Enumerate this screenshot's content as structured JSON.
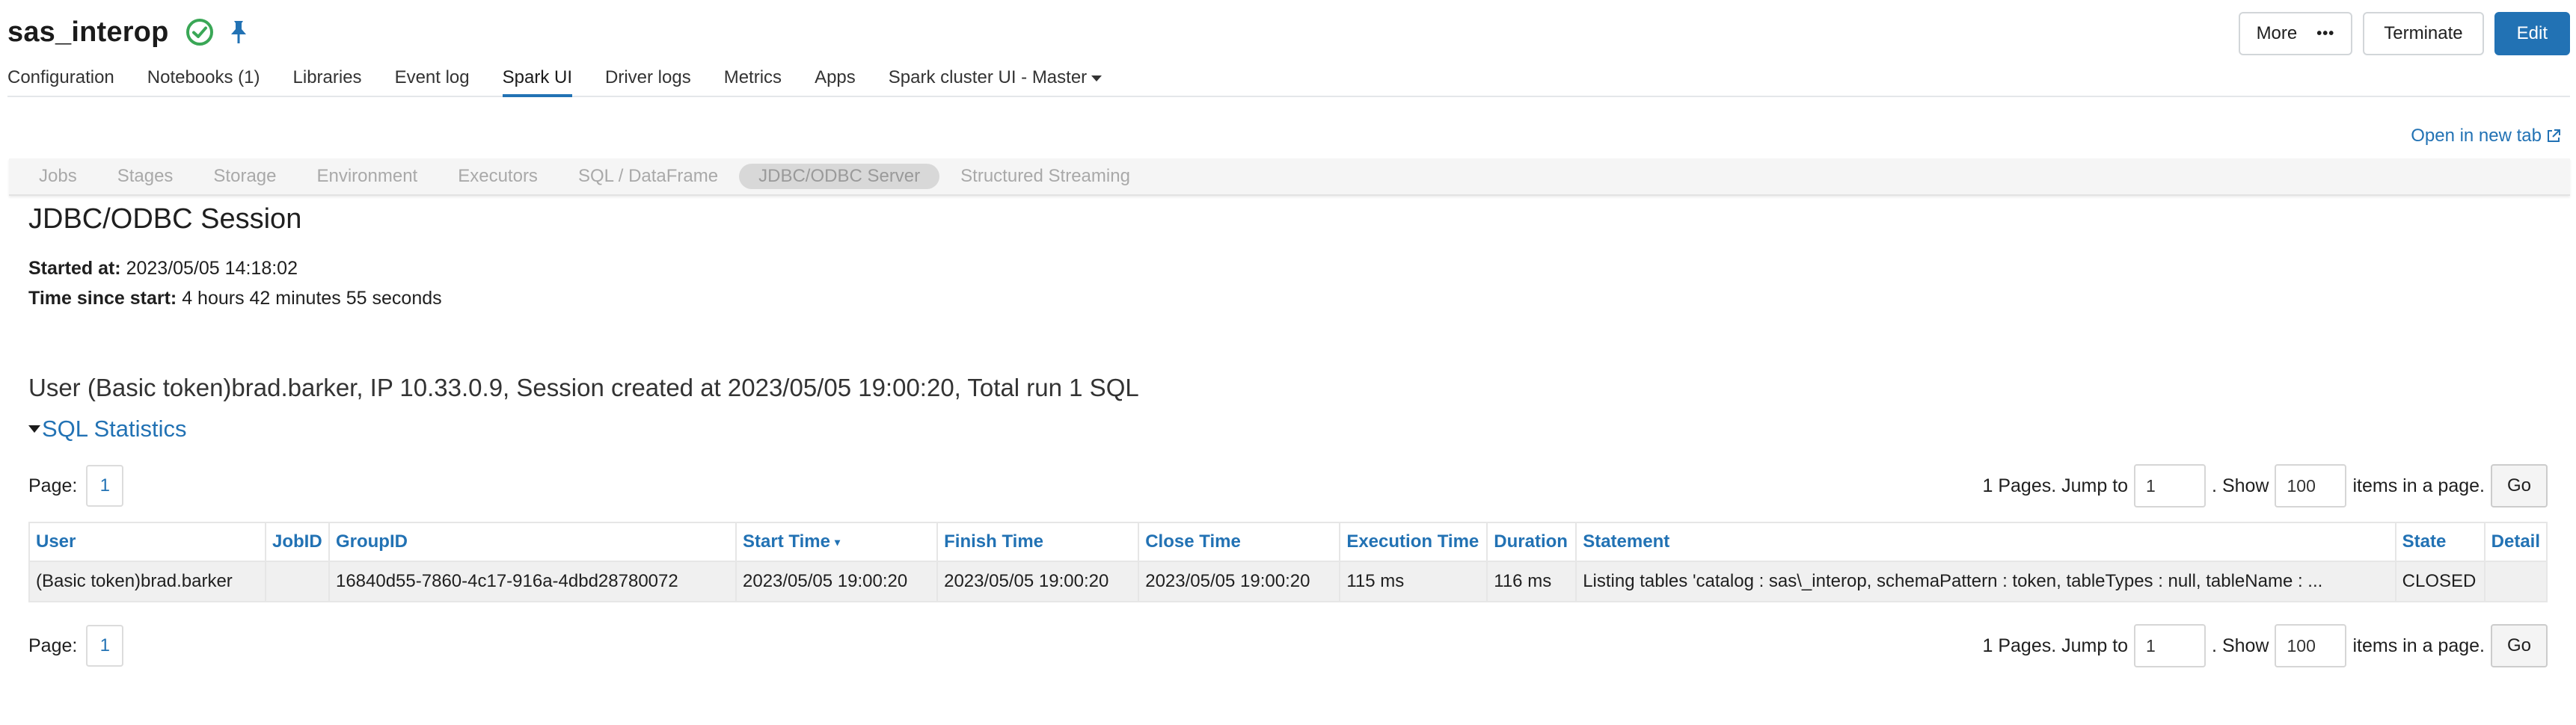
{
  "header": {
    "title": "sas_interop",
    "status_icon": "check-circle-icon",
    "pin_icon": "pin-icon",
    "actions": {
      "more_label": "More",
      "more_icon": "•••",
      "terminate_label": "Terminate",
      "edit_label": "Edit"
    }
  },
  "nav_tabs": [
    {
      "label": "Configuration"
    },
    {
      "label": "Notebooks (1)"
    },
    {
      "label": "Libraries"
    },
    {
      "label": "Event log"
    },
    {
      "label": "Spark UI"
    },
    {
      "label": "Driver logs"
    },
    {
      "label": "Metrics"
    },
    {
      "label": "Apps"
    },
    {
      "label": "Spark cluster UI - Master"
    }
  ],
  "active_tab": "Spark UI",
  "open_new_tab": "Open in new tab",
  "spark_tabs": [
    {
      "label": "Jobs"
    },
    {
      "label": "Stages"
    },
    {
      "label": "Storage"
    },
    {
      "label": "Environment"
    },
    {
      "label": "Executors"
    },
    {
      "label": "SQL / DataFrame"
    },
    {
      "label": "JDBC/ODBC Server"
    },
    {
      "label": "Structured Streaming"
    }
  ],
  "session": {
    "title": "JDBC/ODBC Session",
    "started_label": "Started at:",
    "started_value": "2023/05/05 14:18:02",
    "since_label": "Time since start:",
    "since_value": "4 hours 42 minutes 55 seconds",
    "summary": "User (Basic token)brad.barker, IP 10.33.0.9, Session created at 2023/05/05 19:00:20, Total run 1 SQL",
    "stats_toggle": "SQL Statistics"
  },
  "pager": {
    "page_label": "Page:",
    "current_page": "1",
    "pages_text": "1 Pages. Jump to",
    "jump_value": "1",
    "show_text": ". Show",
    "show_value": "100",
    "items_text": "items in a page.",
    "go_label": "Go"
  },
  "table": {
    "columns": [
      "User",
      "JobID",
      "GroupID",
      "Start Time",
      "Finish Time",
      "Close Time",
      "Execution Time",
      "Duration",
      "Statement",
      "State",
      "Detail"
    ],
    "sort_indicator": "▾",
    "rows": [
      [
        "(Basic token)brad.barker",
        "",
        "16840d55-7860-4c17-916a-4dbd28780072",
        "2023/05/05 19:00:20",
        "2023/05/05 19:00:20",
        "2023/05/05 19:00:20",
        "115 ms",
        "116 ms",
        "Listing tables 'catalog : sas\\_interop, schemaPattern : token, tableTypes : null, tableName : ...",
        "CLOSED",
        ""
      ]
    ]
  },
  "colors": {
    "accent": "#2272b4",
    "success": "#3aa756"
  }
}
